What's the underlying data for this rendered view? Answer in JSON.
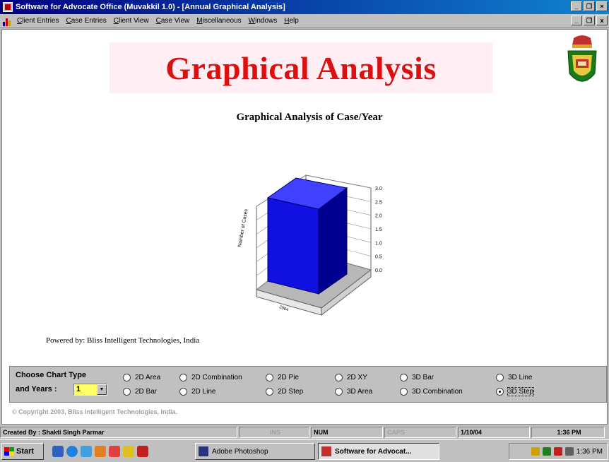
{
  "window": {
    "title": "Software for Advocate Office (Muvakkil 1.0) - [Annual Graphical Analysis]",
    "controls": [
      "_",
      "×",
      "x"
    ]
  },
  "menu": {
    "items": [
      "Client Entries",
      "Case Entries",
      "Client View",
      "Case View",
      "Miscellaneous",
      "Windows",
      "Help"
    ]
  },
  "page": {
    "banner_title": "Graphical Analysis",
    "chart_heading": "Graphical Analysis of Case/Year",
    "powered_by": "Powered by: Bliss Intelligent Technologies, India",
    "copyright": "© Copyright 2003, Bliss Intelligent Technologies, India."
  },
  "chart_data": {
    "type": "bar",
    "style": "3D Step",
    "categories": [
      "2004"
    ],
    "values": [
      3.0
    ],
    "ylabel": "Number of Cases",
    "ylim": [
      0,
      3.0
    ],
    "yticks": [
      "0.0",
      "0.5",
      "1.0",
      "1.5",
      "2.0",
      "2.5",
      "3.0"
    ],
    "color": "#1010e0"
  },
  "options": {
    "chart_type_label": "Choose Chart Type",
    "years_label": "and Years :",
    "years_value": "1",
    "chart_types": [
      {
        "label": "2D Area",
        "selected": false
      },
      {
        "label": "2D Combination",
        "selected": false
      },
      {
        "label": "2D Pie",
        "selected": false
      },
      {
        "label": "2D XY",
        "selected": false
      },
      {
        "label": "3D Bar",
        "selected": false
      },
      {
        "label": "3D Line",
        "selected": false
      },
      {
        "label": "2D Bar",
        "selected": false
      },
      {
        "label": "2D Line",
        "selected": false
      },
      {
        "label": "2D Step",
        "selected": false
      },
      {
        "label": "3D Area",
        "selected": false
      },
      {
        "label": "3D Combination",
        "selected": false
      },
      {
        "label": "3D Step",
        "selected": true
      }
    ]
  },
  "statusbar": {
    "created_by": "Created By : Shakti Singh Parmar",
    "ins": "INS",
    "num": "NUM",
    "caps": "CAPS",
    "date": "1/10/04",
    "time": "1:36 PM"
  },
  "taskbar": {
    "start_label": "Start",
    "tasks": [
      "Adobe Photoshop",
      "Software for Advocat..."
    ],
    "clock": "1:36 PM"
  }
}
